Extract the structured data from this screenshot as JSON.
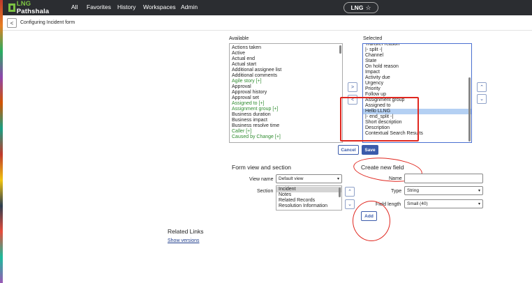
{
  "header": {
    "logo_text_prefix": "LNG",
    "logo_text_rest": " Pathshala",
    "nav": [
      "All",
      "Favorites",
      "History",
      "Workspaces",
      "Admin"
    ],
    "scope_label": "LNG",
    "scope_icon": "star-icon"
  },
  "subheader": {
    "back_icon": "chevron-left-icon",
    "title": "Configuring Incident form"
  },
  "slush": {
    "available_label": "Available",
    "selected_label": "Selected",
    "available": [
      {
        "text": "Actions taken",
        "green": false
      },
      {
        "text": "Active",
        "green": false
      },
      {
        "text": "Actual end",
        "green": false
      },
      {
        "text": "Actual start",
        "green": false
      },
      {
        "text": "Additional assignee list",
        "green": false
      },
      {
        "text": "Additional comments",
        "green": false
      },
      {
        "text": "Agile story [+]",
        "green": true
      },
      {
        "text": "Approval",
        "green": false
      },
      {
        "text": "Approval history",
        "green": false
      },
      {
        "text": "Approval set",
        "green": false
      },
      {
        "text": "Assigned to [+]",
        "green": true
      },
      {
        "text": "Assignment group [+]",
        "green": true
      },
      {
        "text": "Business duration",
        "green": false
      },
      {
        "text": "Business impact",
        "green": false
      },
      {
        "text": "Business resolve time",
        "green": false
      },
      {
        "text": "Caller [+]",
        "green": true
      },
      {
        "text": "Caused by Change [+]",
        "green": true
      }
    ],
    "selected": [
      {
        "text": "Transfer reason",
        "selected": false
      },
      {
        "text": "|- split -|",
        "selected": false
      },
      {
        "text": "Channel",
        "selected": false
      },
      {
        "text": "State",
        "selected": false
      },
      {
        "text": "On hold reason",
        "selected": false
      },
      {
        "text": "Impact",
        "selected": false
      },
      {
        "text": "Activity due",
        "selected": false
      },
      {
        "text": "Urgency",
        "selected": false
      },
      {
        "text": "Priority",
        "selected": false
      },
      {
        "text": "Follow up",
        "selected": false
      },
      {
        "text": "Assignment group",
        "selected": false
      },
      {
        "text": "Assigned to",
        "selected": false
      },
      {
        "text": "Hello LLNG",
        "selected": true
      },
      {
        "text": "|- end_split -|",
        "selected": false
      },
      {
        "text": "Short description",
        "selected": false
      },
      {
        "text": "Description",
        "selected": false
      },
      {
        "text": "Contextual Search Results",
        "selected": false
      }
    ],
    "cancel_label": "Cancel",
    "save_label": "Save"
  },
  "form_view": {
    "title": "Form view and section",
    "view_name_label": "View name",
    "view_name_value": "Default view",
    "section_label": "Section",
    "sections": [
      {
        "text": "Incident",
        "selected": true
      },
      {
        "text": "Notes",
        "selected": false
      },
      {
        "text": "Related Records",
        "selected": false
      },
      {
        "text": "Resolution Information",
        "selected": false
      }
    ]
  },
  "new_field": {
    "title": "Create new field",
    "name_label": "Name",
    "name_value": "",
    "type_label": "Type",
    "type_value": "String",
    "length_label": "Field length",
    "length_value": "Small (40)",
    "add_label": "Add"
  },
  "related": {
    "title": "Related Links",
    "show_versions": "Show versions"
  },
  "colors": {
    "header_bg": "#2b2d31",
    "accent": "#3b5bab",
    "annotation_red": "#e0271f",
    "green_item": "#2e8b2e",
    "highlight": "#b4d0f3"
  }
}
